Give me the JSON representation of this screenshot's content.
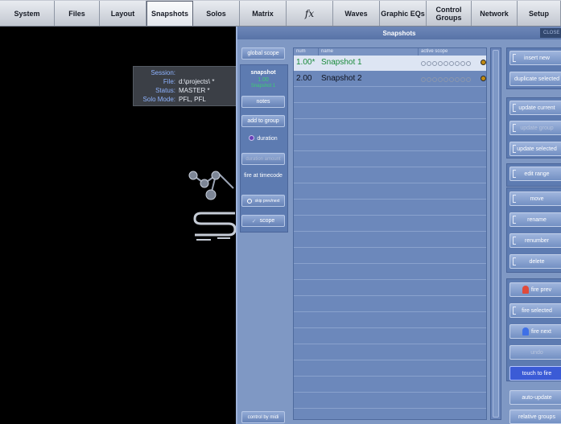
{
  "tabs": [
    {
      "label": "System"
    },
    {
      "label": "Files"
    },
    {
      "label": "Layout"
    },
    {
      "label": "Snapshots"
    },
    {
      "label": "Solos"
    },
    {
      "label": "Matrix"
    },
    {
      "label": "fx"
    },
    {
      "label": "Waves"
    },
    {
      "label": "Graphic EQs"
    },
    {
      "label": "Control Groups"
    },
    {
      "label": "Network"
    },
    {
      "label": "Setup"
    }
  ],
  "session": {
    "title": "Session:",
    "file_label": "File:",
    "file_value": "d:\\projects\\ *",
    "status_label": "Status:",
    "status_value": "MASTER  *",
    "solo_label": "Solo Mode:",
    "solo_value": "PFL, PFL"
  },
  "window": {
    "title": "Snapshots",
    "close_label": "CLOSE"
  },
  "left": {
    "global_scope": "global scope",
    "snapshot_label": "snapshot",
    "snapshot_num": "1.00",
    "snapshot_name": "Snapshot 1",
    "notes": "notes",
    "add_to_group": "add to group",
    "duration": "duration",
    "duration_amount": "duration amount",
    "fire_at_timecode": "fire at timecode",
    "skip_prev_next": "skip prev/next",
    "scope": "scope",
    "control_by_midi": "control by midi"
  },
  "list": {
    "headers": {
      "num": "num",
      "name": "name",
      "active_scope": "active scope"
    },
    "rows": [
      {
        "num": "1.00*",
        "name": "Snapshot 1",
        "selected": true
      },
      {
        "num": "2.00",
        "name": "Snapshot 2",
        "selected": false
      }
    ]
  },
  "right": {
    "insert_new": "insert new",
    "duplicate_selected": "duplicate selected",
    "update_current": "update current",
    "update_group": "update group",
    "update_selected": "update selected",
    "edit_range": "edit range",
    "move": "move",
    "rename": "rename",
    "renumber": "renumber",
    "delete": "delete",
    "fire_prev": "fire prev",
    "fire_selected": "fire selected",
    "fire_next": "fire next",
    "undo": "undo",
    "touch_to_fire": "touch to fire",
    "auto_update": "auto-update",
    "relative_groups": "relative groups"
  },
  "colors": {
    "window_bg": "#7f98c4",
    "selected_text": "#198a3a",
    "touch_to_fire": "#3b5bd6",
    "session_text": "#8eb3ff"
  }
}
